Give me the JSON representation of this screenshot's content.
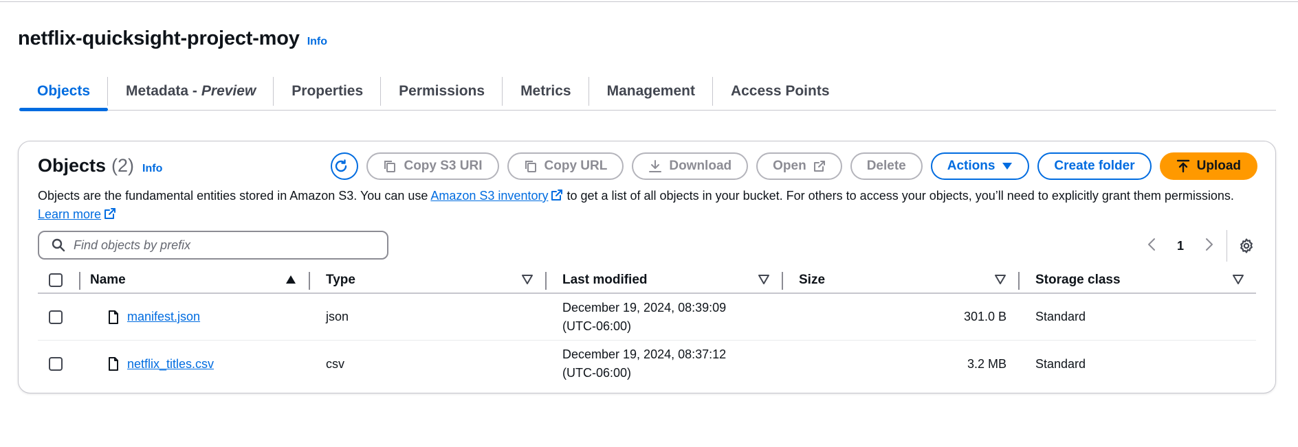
{
  "bucket": {
    "title": "netflix-quicksight-project-moy",
    "info": "Info"
  },
  "tabs": [
    {
      "label": "Objects",
      "active": true
    },
    {
      "label": "Metadata -",
      "suffix": "Preview"
    },
    {
      "label": "Properties"
    },
    {
      "label": "Permissions"
    },
    {
      "label": "Metrics"
    },
    {
      "label": "Management"
    },
    {
      "label": "Access Points"
    }
  ],
  "objects_panel": {
    "title": "Objects",
    "count": "(2)",
    "info": "Info",
    "toolbar": {
      "refresh_icon": "refresh-icon",
      "copy_s3_uri": "Copy S3 URI",
      "copy_url": "Copy URL",
      "download": "Download",
      "open": "Open",
      "delete": "Delete",
      "actions": "Actions",
      "create_folder": "Create folder",
      "upload": "Upload"
    },
    "description": {
      "part1": "Objects are the fundamental entities stored in Amazon S3. You can use ",
      "link1": "Amazon S3 inventory",
      "part2": " to get a list of all objects in your bucket. For others to access your objects, you’ll need to explicitly grant them permissions. ",
      "link2": "Learn more"
    },
    "search": {
      "placeholder": "Find objects by prefix",
      "value": ""
    },
    "pagination": {
      "current_page": "1"
    },
    "table": {
      "columns": [
        "Name",
        "Type",
        "Last modified",
        "Size",
        "Storage class"
      ],
      "rows": [
        {
          "name": "manifest.json",
          "type": "json",
          "last_modified_date": "December 19, 2024, 08:39:09",
          "last_modified_tz": "(UTC-06:00)",
          "size": "301.0 B",
          "storage_class": "Standard"
        },
        {
          "name": "netflix_titles.csv",
          "type": "csv",
          "last_modified_date": "December 19, 2024, 08:37:12",
          "last_modified_tz": "(UTC-06:00)",
          "size": "3.2 MB",
          "storage_class": "Standard"
        }
      ]
    }
  },
  "colors": {
    "link": "#006ce0",
    "primary": "#ff9900",
    "border": "#c6c6cd",
    "disabled": "#8c8c94"
  }
}
